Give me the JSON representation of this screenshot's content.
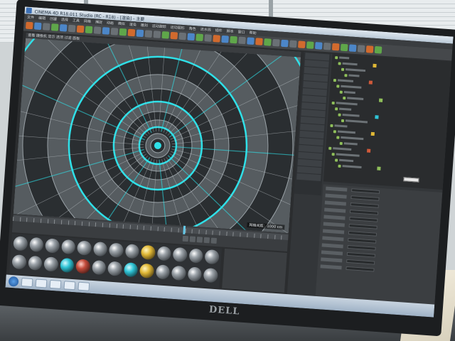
{
  "window": {
    "title": "CINEMA 4D R18.011 Studio (RC - R18) - [渲染] - 主要"
  },
  "menu": [
    "文件",
    "编辑",
    "创建",
    "选择",
    "工具",
    "网格",
    "捕捉",
    "动画",
    "模拟",
    "渲染",
    "雕刻",
    "运动跟踪",
    "运动图形",
    "角色",
    "流水线",
    "插件",
    "脚本",
    "窗口",
    "帮助"
  ],
  "viewport": {
    "header": "查看 摄像机 显示 选项 过滤 面板",
    "badge": "网格间距：1000 cm"
  },
  "monitor": {
    "brand": "DELL"
  },
  "colors": {
    "accent": "#2fe0e8",
    "app_bg": "#2b2d2f",
    "bezel": "#1c1e20"
  }
}
